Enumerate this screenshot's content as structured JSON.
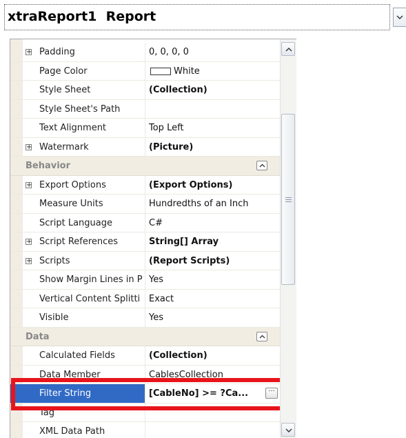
{
  "selector": {
    "label": "xtraReport1  Report",
    "dropdown_icon": "chevron-down-icon"
  },
  "rows": [
    {
      "kind": "prop",
      "name": "Padding",
      "value": "0, 0, 0, 0",
      "expandable": true,
      "bold": false
    },
    {
      "kind": "prop",
      "name": "Page Color",
      "value": "White",
      "expandable": false,
      "bold": false,
      "swatch": "#ffffff"
    },
    {
      "kind": "prop",
      "name": "Style Sheet",
      "value": "(Collection)",
      "expandable": false,
      "bold": true
    },
    {
      "kind": "prop",
      "name": "Style Sheet's Path",
      "value": "",
      "expandable": false,
      "bold": false
    },
    {
      "kind": "prop",
      "name": "Text Alignment",
      "value": "Top Left",
      "expandable": false,
      "bold": false
    },
    {
      "kind": "prop",
      "name": "Watermark",
      "value": "(Picture)",
      "expandable": true,
      "bold": true
    },
    {
      "kind": "category",
      "name": "Behavior"
    },
    {
      "kind": "prop",
      "name": "Export Options",
      "value": "(Export Options)",
      "expandable": true,
      "bold": true
    },
    {
      "kind": "prop",
      "name": "Measure Units",
      "value": "Hundredths of an Inch",
      "expandable": false,
      "bold": false
    },
    {
      "kind": "prop",
      "name": "Script Language",
      "value": "C#",
      "expandable": false,
      "bold": false
    },
    {
      "kind": "prop",
      "name": "Script References",
      "value": "String[] Array",
      "expandable": true,
      "bold": true
    },
    {
      "kind": "prop",
      "name": "Scripts",
      "value": "(Report Scripts)",
      "expandable": true,
      "bold": true
    },
    {
      "kind": "prop",
      "name": "Show Margin Lines in P",
      "value": "Yes",
      "expandable": false,
      "bold": false
    },
    {
      "kind": "prop",
      "name": "Vertical Content Splitti",
      "value": "Exact",
      "expandable": false,
      "bold": false
    },
    {
      "kind": "prop",
      "name": "Visible",
      "value": "Yes",
      "expandable": false,
      "bold": false
    },
    {
      "kind": "category",
      "name": "Data"
    },
    {
      "kind": "prop",
      "name": "Calculated Fields",
      "value": "(Collection)",
      "expandable": false,
      "bold": true
    },
    {
      "kind": "prop",
      "name": "Data Member",
      "value": "CablesCollection",
      "expandable": false,
      "bold": false
    },
    {
      "kind": "prop",
      "name": "Filter String",
      "value": "[CableNo] >= ?Ca...",
      "expandable": false,
      "bold": true,
      "selected": true,
      "ellipsis": "···"
    },
    {
      "kind": "prop",
      "name": "Tag",
      "value": "",
      "expandable": false,
      "bold": false
    },
    {
      "kind": "prop",
      "name": "XML Data Path",
      "value": "",
      "expandable": false,
      "bold": false
    }
  ],
  "colors": {
    "selection": "#316ac5",
    "highlight_box": "#e8141b",
    "category_bg": "#f1ede3"
  },
  "scrollbar": {
    "up_icon": "chevron-up-icon",
    "down_icon": "chevron-down-icon"
  }
}
